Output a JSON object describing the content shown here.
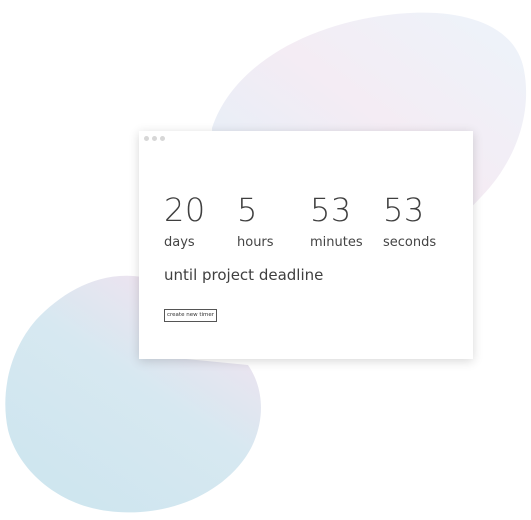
{
  "window": {
    "controls": [
      "dot",
      "dot",
      "dot"
    ]
  },
  "countdown": {
    "days": {
      "value": "20",
      "label": "days"
    },
    "hours": {
      "value": "5",
      "label": "hours"
    },
    "minutes": {
      "value": "53",
      "label": "minutes"
    },
    "seconds": {
      "value": "53",
      "label": "seconds"
    },
    "caption": "until project deadline"
  },
  "actions": {
    "create_label": "create new timer"
  },
  "colors": {
    "text": "#3f3f3f",
    "blob_blue": "#cfe7f0",
    "blob_pink": "#f3e6f1",
    "window_bg": "#ffffff"
  }
}
